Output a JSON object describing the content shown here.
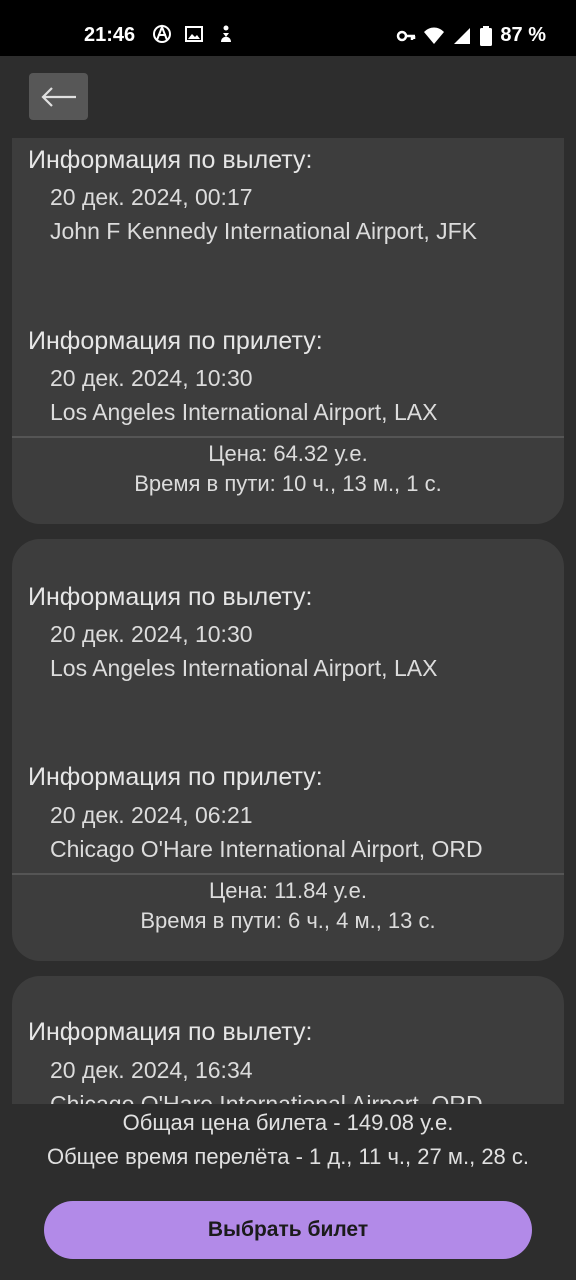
{
  "status_bar": {
    "time": "21:46",
    "battery": "87 %",
    "left_icons": [
      "vpn-anarchy-icon",
      "image-icon",
      "accessibility-icon"
    ],
    "right_icons": [
      "key-icon",
      "wifi-icon",
      "signal-icon",
      "battery-icon"
    ]
  },
  "app_bar": {
    "back_icon": "arrow-left-icon"
  },
  "cards": [
    {
      "departure_title": "Информация по вылету:",
      "departure_datetime": "20 дек. 2024, 00:17",
      "departure_airport": "John F Kennedy International Airport, JFK",
      "arrival_title": "Информация по прилету:",
      "arrival_datetime": "20 дек. 2024, 10:30",
      "arrival_airport": "Los Angeles International Airport, LAX",
      "price": "Цена: 64.32 у.е.",
      "duration": "Время в пути: 10 ч., 13 м., 1 с."
    },
    {
      "departure_title": "Информация по вылету:",
      "departure_datetime": "20 дек. 2024, 10:30",
      "departure_airport": "Los Angeles International Airport, LAX",
      "arrival_title": "Информация по прилету:",
      "arrival_datetime": "20 дек. 2024, 06:21",
      "arrival_airport": "Chicago O'Hare International Airport, ORD",
      "price": "Цена: 11.84 у.е.",
      "duration": "Время в пути: 6 ч., 4 м., 13 с."
    },
    {
      "departure_title": "Информация по вылету:",
      "departure_datetime": "20 дек. 2024, 16:34",
      "departure_airport": "Chicago O'Hare International Airport, ORD"
    }
  ],
  "footer": {
    "total_price": "Общая цена билета - 149.08 у.е.",
    "total_time": "Общее время перелёта - 1 д., 11 ч., 27 м., 28 с.",
    "select_button": "Выбрать билет"
  },
  "colors": {
    "accent": "#b28ae8",
    "card": "#3d3d3d",
    "background": "#2d2d2d"
  }
}
